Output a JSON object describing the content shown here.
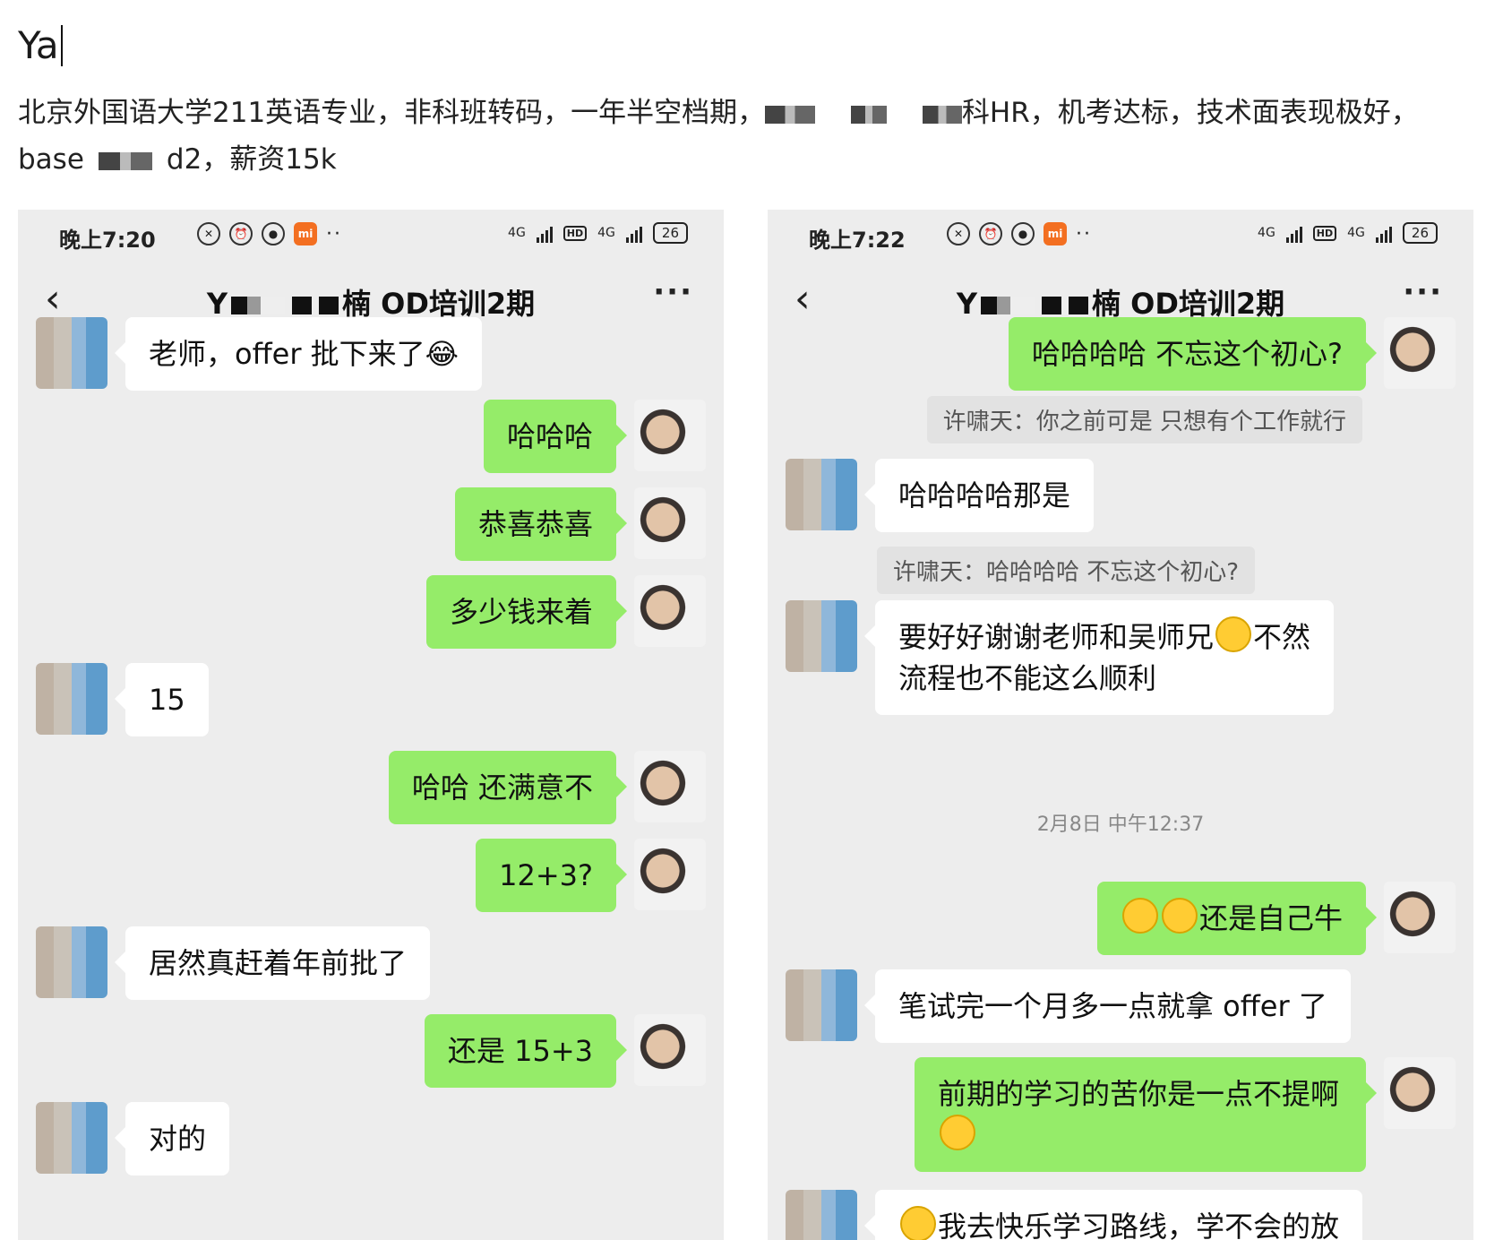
{
  "document": {
    "heading": "Ya",
    "intro_line1_a": "北京外国语大学211英语专业，非科班转码，一年半空档期，",
    "intro_line1_b": "科HR，机考达标，技术面表现极好，",
    "intro_line2_a": "base",
    "intro_line2_b": "d2，薪资15k"
  },
  "left_phone": {
    "status": {
      "time": "晚上7:20",
      "net1": "4G",
      "hd": "HD",
      "net2": "4G",
      "battery": "26"
    },
    "title_prefix": "Y",
    "title_suffix": "楠 OD培训2期",
    "messages": [
      {
        "side": "other",
        "text": "老师，offer 批下来了😂"
      },
      {
        "side": "me",
        "text": "哈哈哈"
      },
      {
        "side": "me",
        "text": "恭喜恭喜"
      },
      {
        "side": "me",
        "text": "多少钱来着"
      },
      {
        "side": "other",
        "text": "15"
      },
      {
        "side": "me",
        "text": "哈哈 还满意不"
      },
      {
        "side": "me",
        "text": "12+3?"
      },
      {
        "side": "other",
        "text": "居然真赶着年前批了"
      },
      {
        "side": "me",
        "text": "还是 15+3"
      },
      {
        "side": "other",
        "text": "对的"
      }
    ]
  },
  "right_phone": {
    "status": {
      "time": "晚上7:22",
      "net1": "4G",
      "hd": "HD",
      "net2": "4G",
      "battery": "26"
    },
    "title_prefix": "Y",
    "title_suffix": "楠 OD培训2期",
    "messages": {
      "m1": "哈哈哈哈 不忘这个初心?",
      "q1": "许啸天：你之前可是 只想有个工作就行",
      "m2": "哈哈哈哈那是",
      "q2": "许啸天：哈哈哈哈 不忘这个初心?",
      "m3a": "要好好谢谢老师和吴师兄",
      "m3b": "不然",
      "m3c": "流程也不能这么顺利",
      "timestamp": "2月8日 中午12:37",
      "m4": "还是自己牛",
      "m5": "笔试完一个月多一点就拿 offer 了",
      "m6": "前期的学习的苦你是一点不提啊",
      "m7": "我去快乐学习路线，学不会的放"
    }
  }
}
